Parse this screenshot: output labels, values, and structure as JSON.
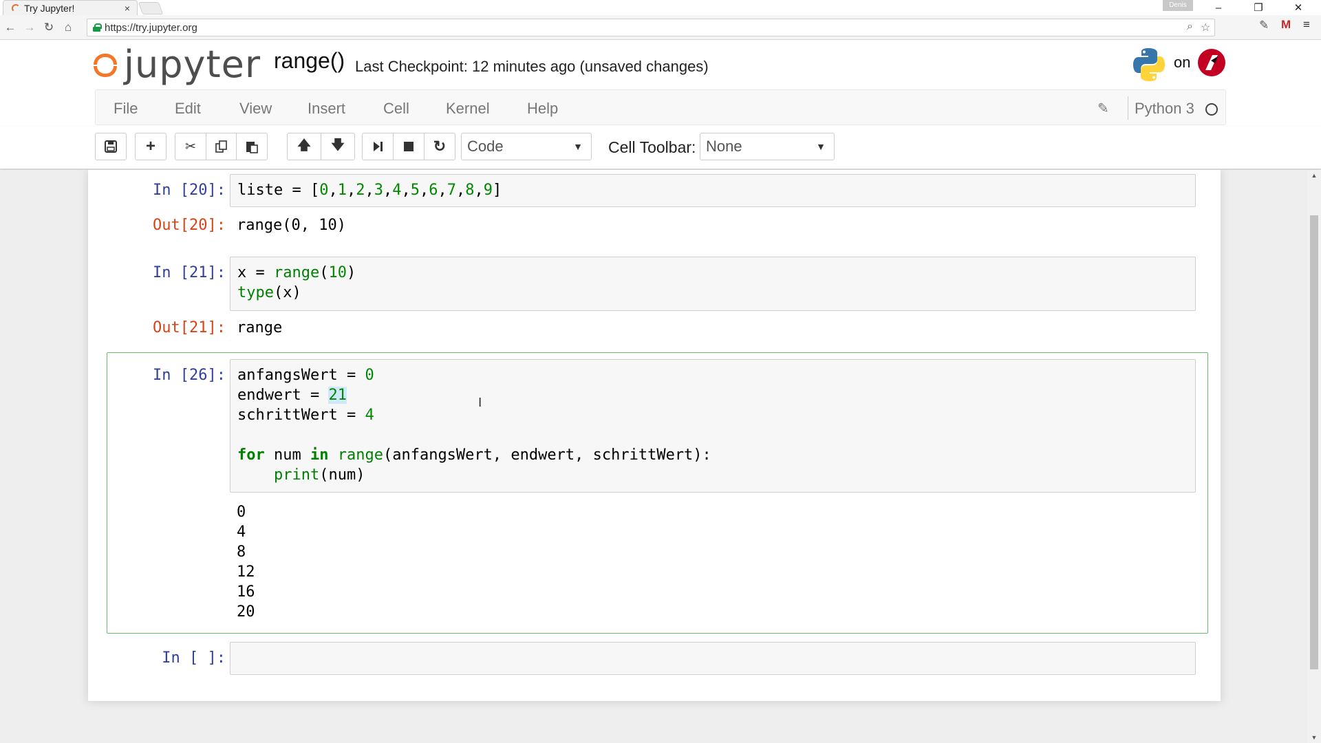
{
  "browser": {
    "tab_title": "Try Jupyter!",
    "tab_close": "×",
    "user_badge": "Denis",
    "url": "https://try.jupyter.org",
    "controls": {
      "minimize": "–",
      "restore": "❐",
      "close": "✕"
    }
  },
  "header": {
    "logo_text": "jupyter",
    "notebook_name": "range()",
    "checkpoint": "Last Checkpoint: 12 minutes ago (unsaved changes)",
    "on_label": "on"
  },
  "menubar": {
    "items": [
      "File",
      "Edit",
      "View",
      "Insert",
      "Cell",
      "Kernel",
      "Help"
    ],
    "kernel_name": "Python 3"
  },
  "toolbar": {
    "cell_type": "Code",
    "cell_toolbar_label": "Cell Toolbar:",
    "cell_toolbar_value": "None"
  },
  "cells": [
    {
      "in_prompt": "In [20]:",
      "code": "liste = [0,1,2,3,4,5,6,7,8,9]",
      "out_prompt": "Out[20]:",
      "output": "range(0, 10)"
    },
    {
      "in_prompt": "In [21]:",
      "code_lines": [
        "x = range(10)",
        "type(x)"
      ],
      "out_prompt": "Out[21]:",
      "output": "range"
    },
    {
      "in_prompt": "In [26]:",
      "code_lines": [
        "anfangsWert = 0",
        "endwert = 21",
        "schrittWert = 4",
        "",
        "for num in range(anfangsWert, endwert, schrittWert):",
        "    print(num)"
      ],
      "output_lines": [
        "0",
        "4",
        "8",
        "12",
        "16",
        "20"
      ]
    },
    {
      "in_prompt": "In [ ]:",
      "code": ""
    }
  ],
  "colors": {
    "in_prompt": "#303f9f",
    "out_prompt": "#d84315",
    "selected_border": "#66bb6a",
    "jupyter_orange": "#f37726"
  }
}
